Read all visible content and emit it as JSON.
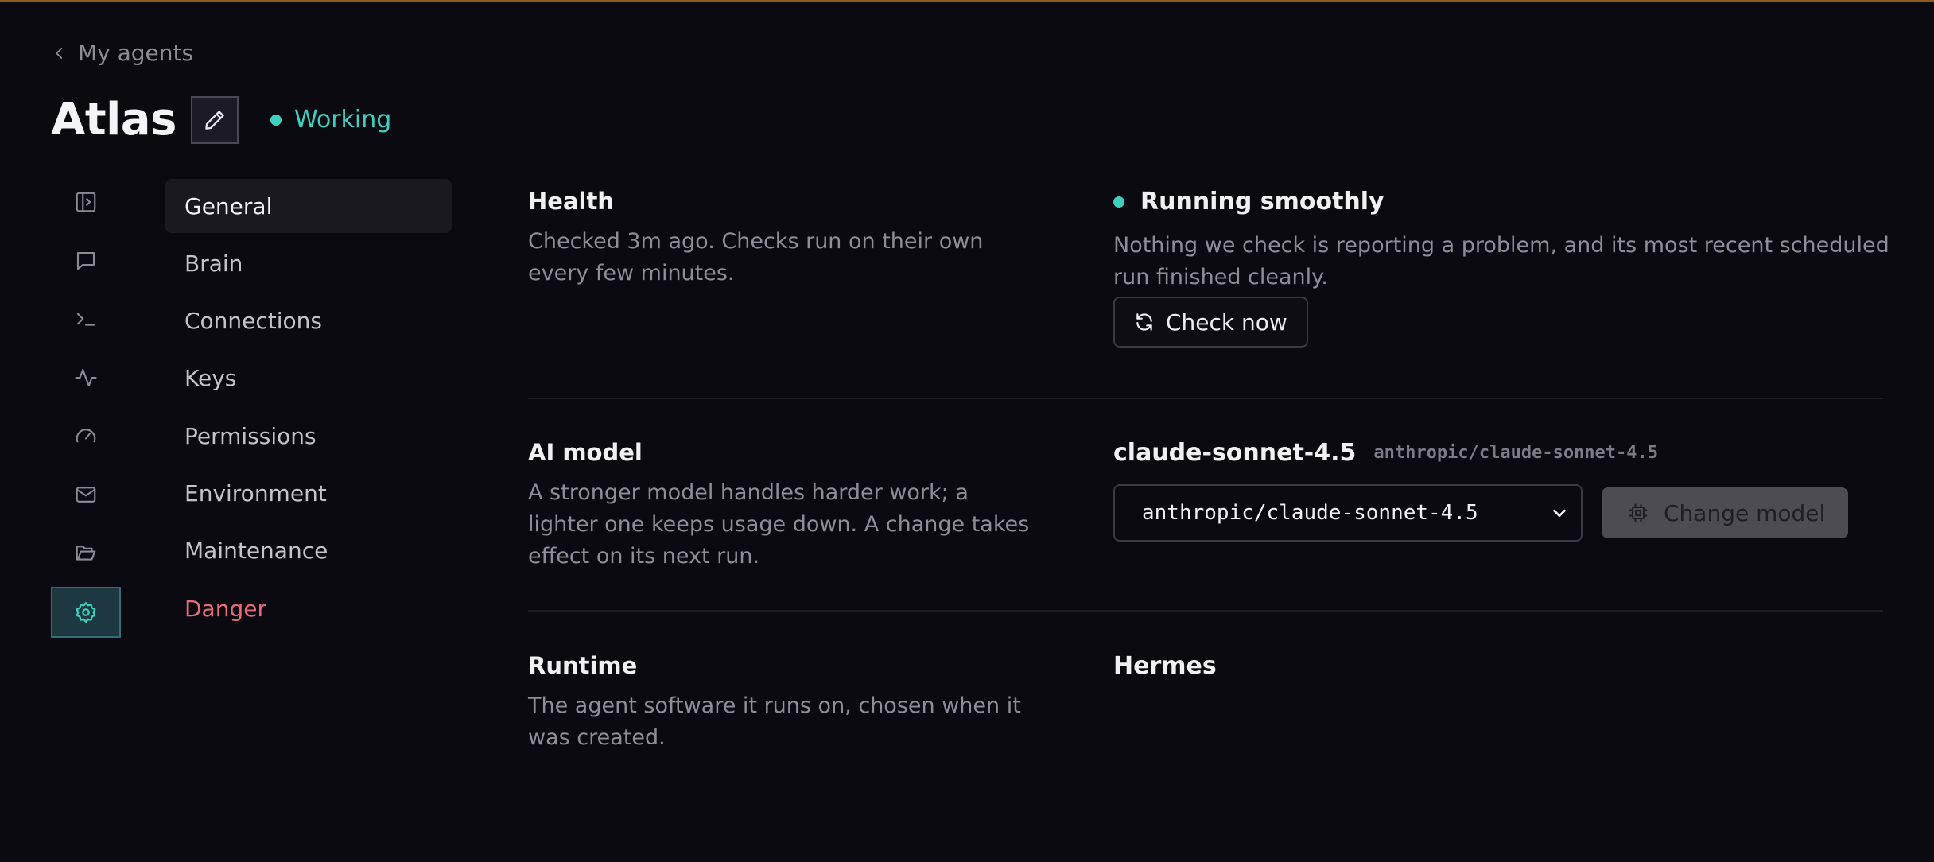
{
  "breadcrumb": {
    "back_label": "My agents"
  },
  "agent": {
    "name": "Atlas",
    "status": "Working"
  },
  "rail": {
    "items": [
      {
        "icon": "sidebar-toggle-icon"
      },
      {
        "icon": "chat-icon"
      },
      {
        "icon": "terminal-icon"
      },
      {
        "icon": "activity-icon"
      },
      {
        "icon": "gauge-icon"
      },
      {
        "icon": "mail-icon"
      },
      {
        "icon": "folder-icon"
      },
      {
        "icon": "gear-icon",
        "active": true
      }
    ]
  },
  "subnav": {
    "items": [
      {
        "label": "General"
      },
      {
        "label": "Brain"
      },
      {
        "label": "Connections"
      },
      {
        "label": "Keys"
      },
      {
        "label": "Permissions"
      },
      {
        "label": "Environment"
      },
      {
        "label": "Maintenance"
      },
      {
        "label": "Danger"
      }
    ]
  },
  "health": {
    "label": "Health",
    "description": "Checked 3m ago. Checks run on their own every few minutes.",
    "status": "Running smoothly",
    "status_description": "Nothing we check is reporting a problem, and its most recent scheduled run finished cleanly.",
    "check_button": "Check now"
  },
  "model": {
    "label": "AI model",
    "description": "A stronger model handles harder work; a lighter one keeps usage down. A change takes effect on its next run.",
    "current_name": "claude-sonnet-4.5",
    "current_id": "anthropic/claude-sonnet-4.5",
    "selected_option": "anthropic/claude-sonnet-4.5",
    "change_button": "Change model"
  },
  "runtime": {
    "label": "Runtime",
    "description": "The agent software it runs on, chosen when it was created.",
    "value": "Hermes"
  },
  "colors": {
    "accent": "#3fcfbf",
    "danger": "#e96b7b",
    "background": "#0b0a10"
  }
}
